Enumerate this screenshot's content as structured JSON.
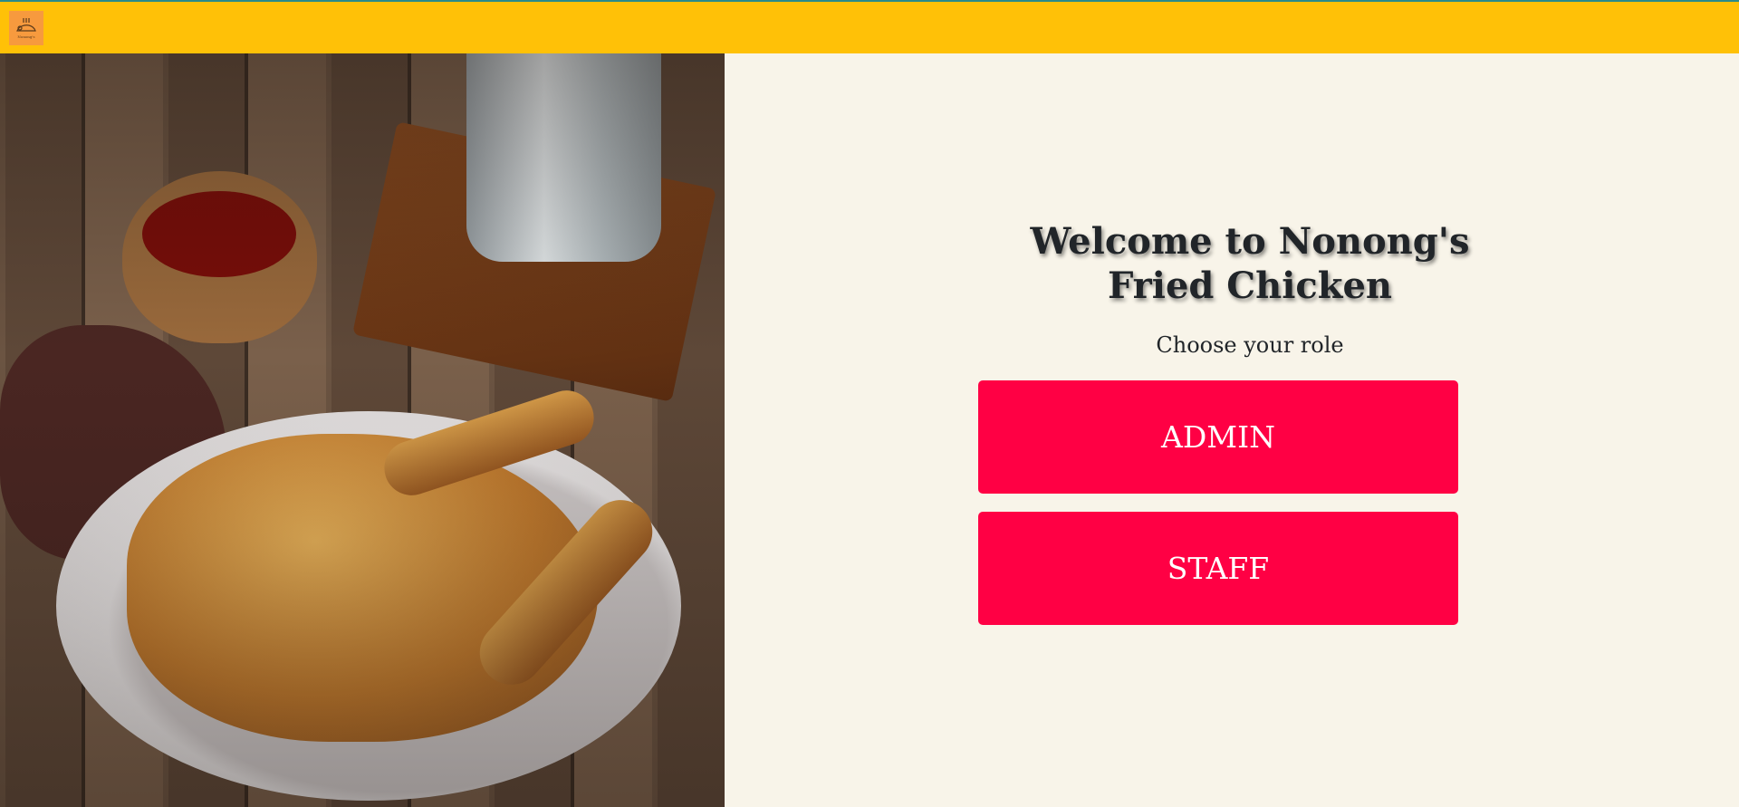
{
  "header": {
    "logo_icon": "fried-chicken-logo",
    "logo_text": "Nonong's"
  },
  "hero": {
    "image": "roast-chicken-photo"
  },
  "welcome": {
    "title_line1": "Welcome to Nonong's",
    "title_line2": "Fried Chicken",
    "subtitle": "Choose your role"
  },
  "roles": {
    "admin": "ADMIN",
    "staff": "STAFF"
  },
  "colors": {
    "header": "#ffc107",
    "button": "#ff0044",
    "background": "#f8f4e9"
  }
}
